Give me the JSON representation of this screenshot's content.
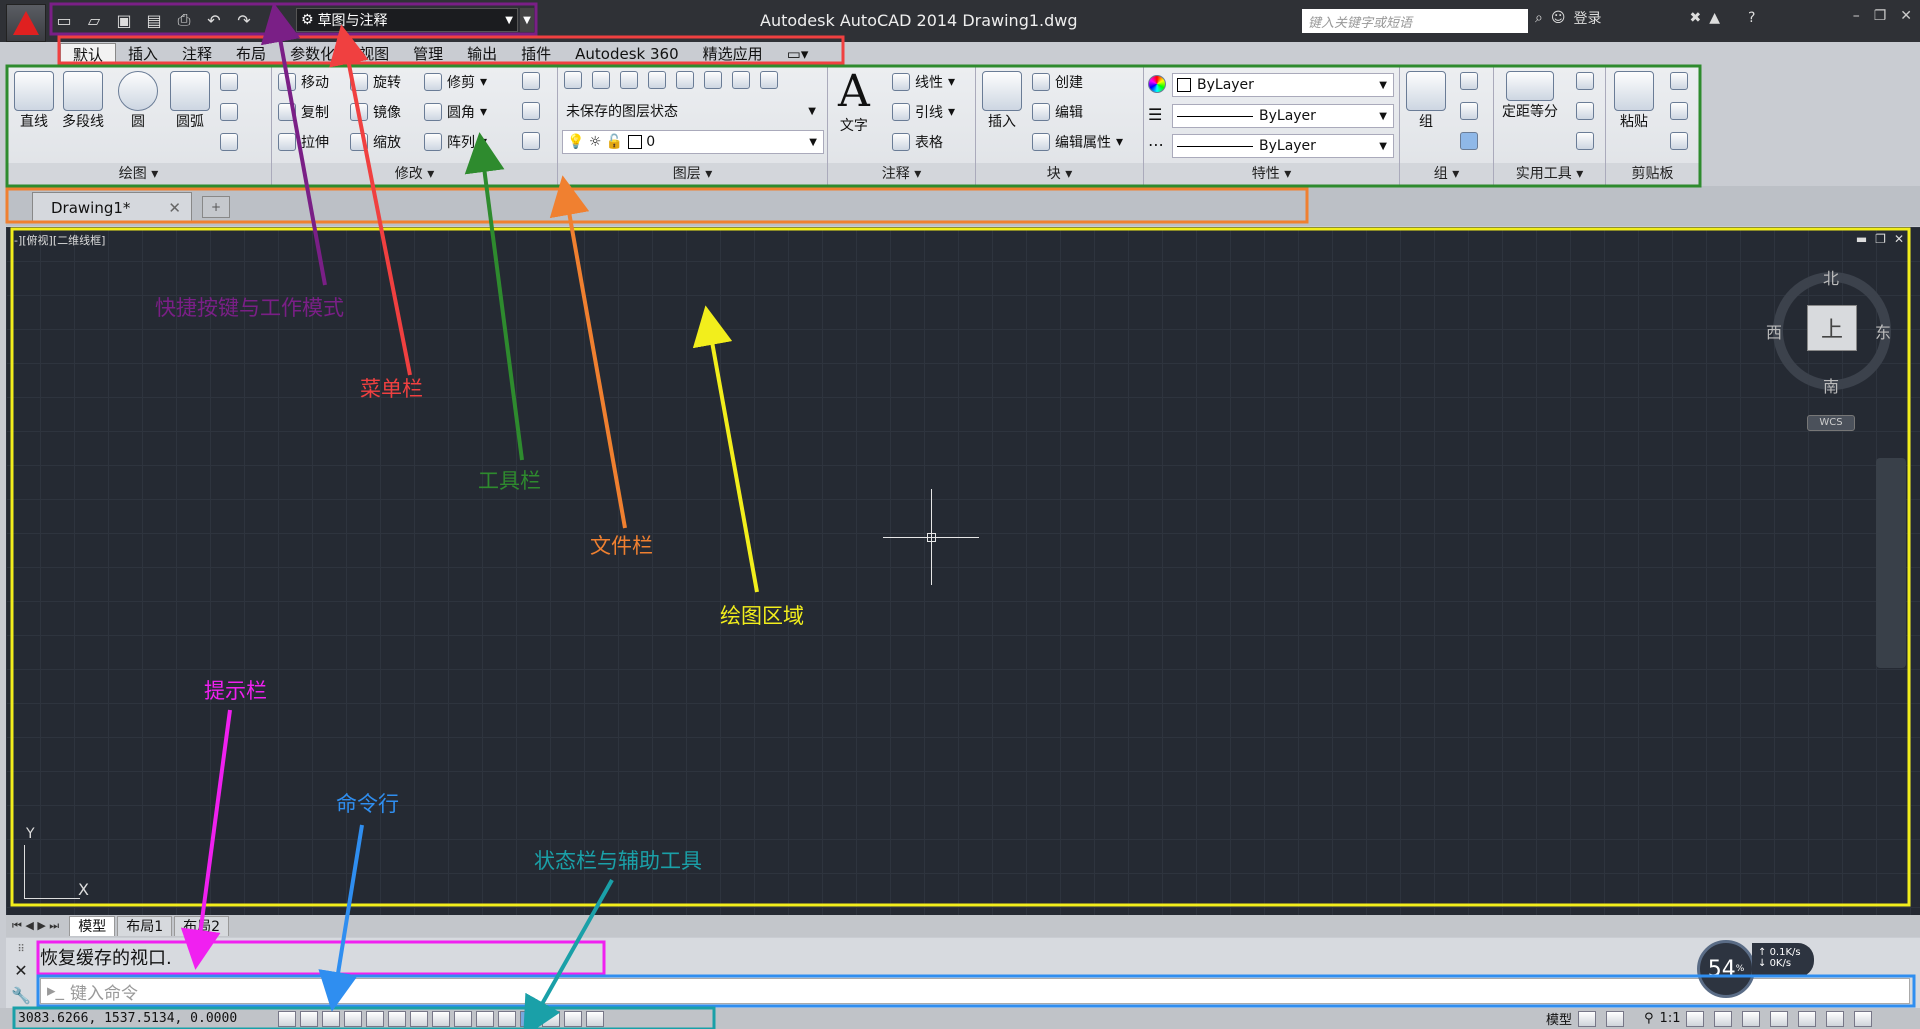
{
  "window": {
    "title": "Autodesk AutoCAD 2014    Drawing1.dwg",
    "search_placeholder": "键入关键字或短语",
    "signin": "登录",
    "workspace": "草图与注释"
  },
  "menu_tabs": [
    "默认",
    "插入",
    "注释",
    "布局",
    "参数化",
    "视图",
    "管理",
    "输出",
    "插件",
    "Autodesk 360",
    "精选应用"
  ],
  "ribbon": {
    "draw": {
      "label": "绘图",
      "line": "直线",
      "polyline": "多段线",
      "circle": "圆",
      "arc": "圆弧"
    },
    "modify": {
      "label": "修改",
      "move": "移动",
      "rotate": "旋转",
      "trim": "修剪",
      "copy": "复制",
      "mirror": "镜像",
      "fillet": "圆角",
      "stretch": "拉伸",
      "scale": "缩放",
      "array": "阵列"
    },
    "layers": {
      "label": "图层",
      "state": "未保存的图层状态",
      "current": "0"
    },
    "annotation": {
      "label": "注释",
      "text": "文字",
      "linear": "线性",
      "leader": "引线",
      "table": "表格"
    },
    "block": {
      "label": "块",
      "insert": "插入",
      "create": "创建",
      "edit": "编辑",
      "edit_attr": "编辑属性"
    },
    "properties": {
      "label": "特性",
      "color": "ByLayer",
      "linetype": "ByLayer",
      "lineweight": "ByLayer"
    },
    "group": {
      "label": "组",
      "group": "组"
    },
    "utilities": {
      "label": "实用工具",
      "measure": "定距等分"
    },
    "clipboard": {
      "label": "剪贴板",
      "paste": "粘贴"
    }
  },
  "file_tab": {
    "name": "Drawing1*"
  },
  "viewport": {
    "label": "-][俯视][二维线框]",
    "viewcube": {
      "north": "北",
      "south": "南",
      "east": "东",
      "west": "西",
      "top": "上",
      "wcs": "WCS"
    },
    "ucs": {
      "x": "X",
      "y": "Y"
    }
  },
  "layout_tabs": [
    "模型",
    "布局1",
    "布局2"
  ],
  "command": {
    "history": "恢复缓存的视口.",
    "placeholder": "键入命令"
  },
  "status": {
    "coords": "3083.6266, 1537.5134, 0.0000",
    "model": "模型",
    "scale": "1:1"
  },
  "perf": {
    "percent": "54",
    "percent_unit": "%",
    "up": "0.1K/s",
    "down": "0K/s"
  },
  "annotations": {
    "qat": "快捷按键与工作模式",
    "menubar": "菜单栏",
    "toolbar": "工具栏",
    "filebar": "文件栏",
    "drawing": "绘图区域",
    "prompt": "提示栏",
    "command": "命令行",
    "status": "状态栏与辅助工具"
  },
  "colors": {
    "purple": "#7a1f86",
    "red": "#f04040",
    "green": "#2e8b2e",
    "orange": "#f08030",
    "yellow": "#f2ee1c",
    "magenta": "#f020f0",
    "blue": "#2f8ef0",
    "teal": "#1aa0a8"
  }
}
